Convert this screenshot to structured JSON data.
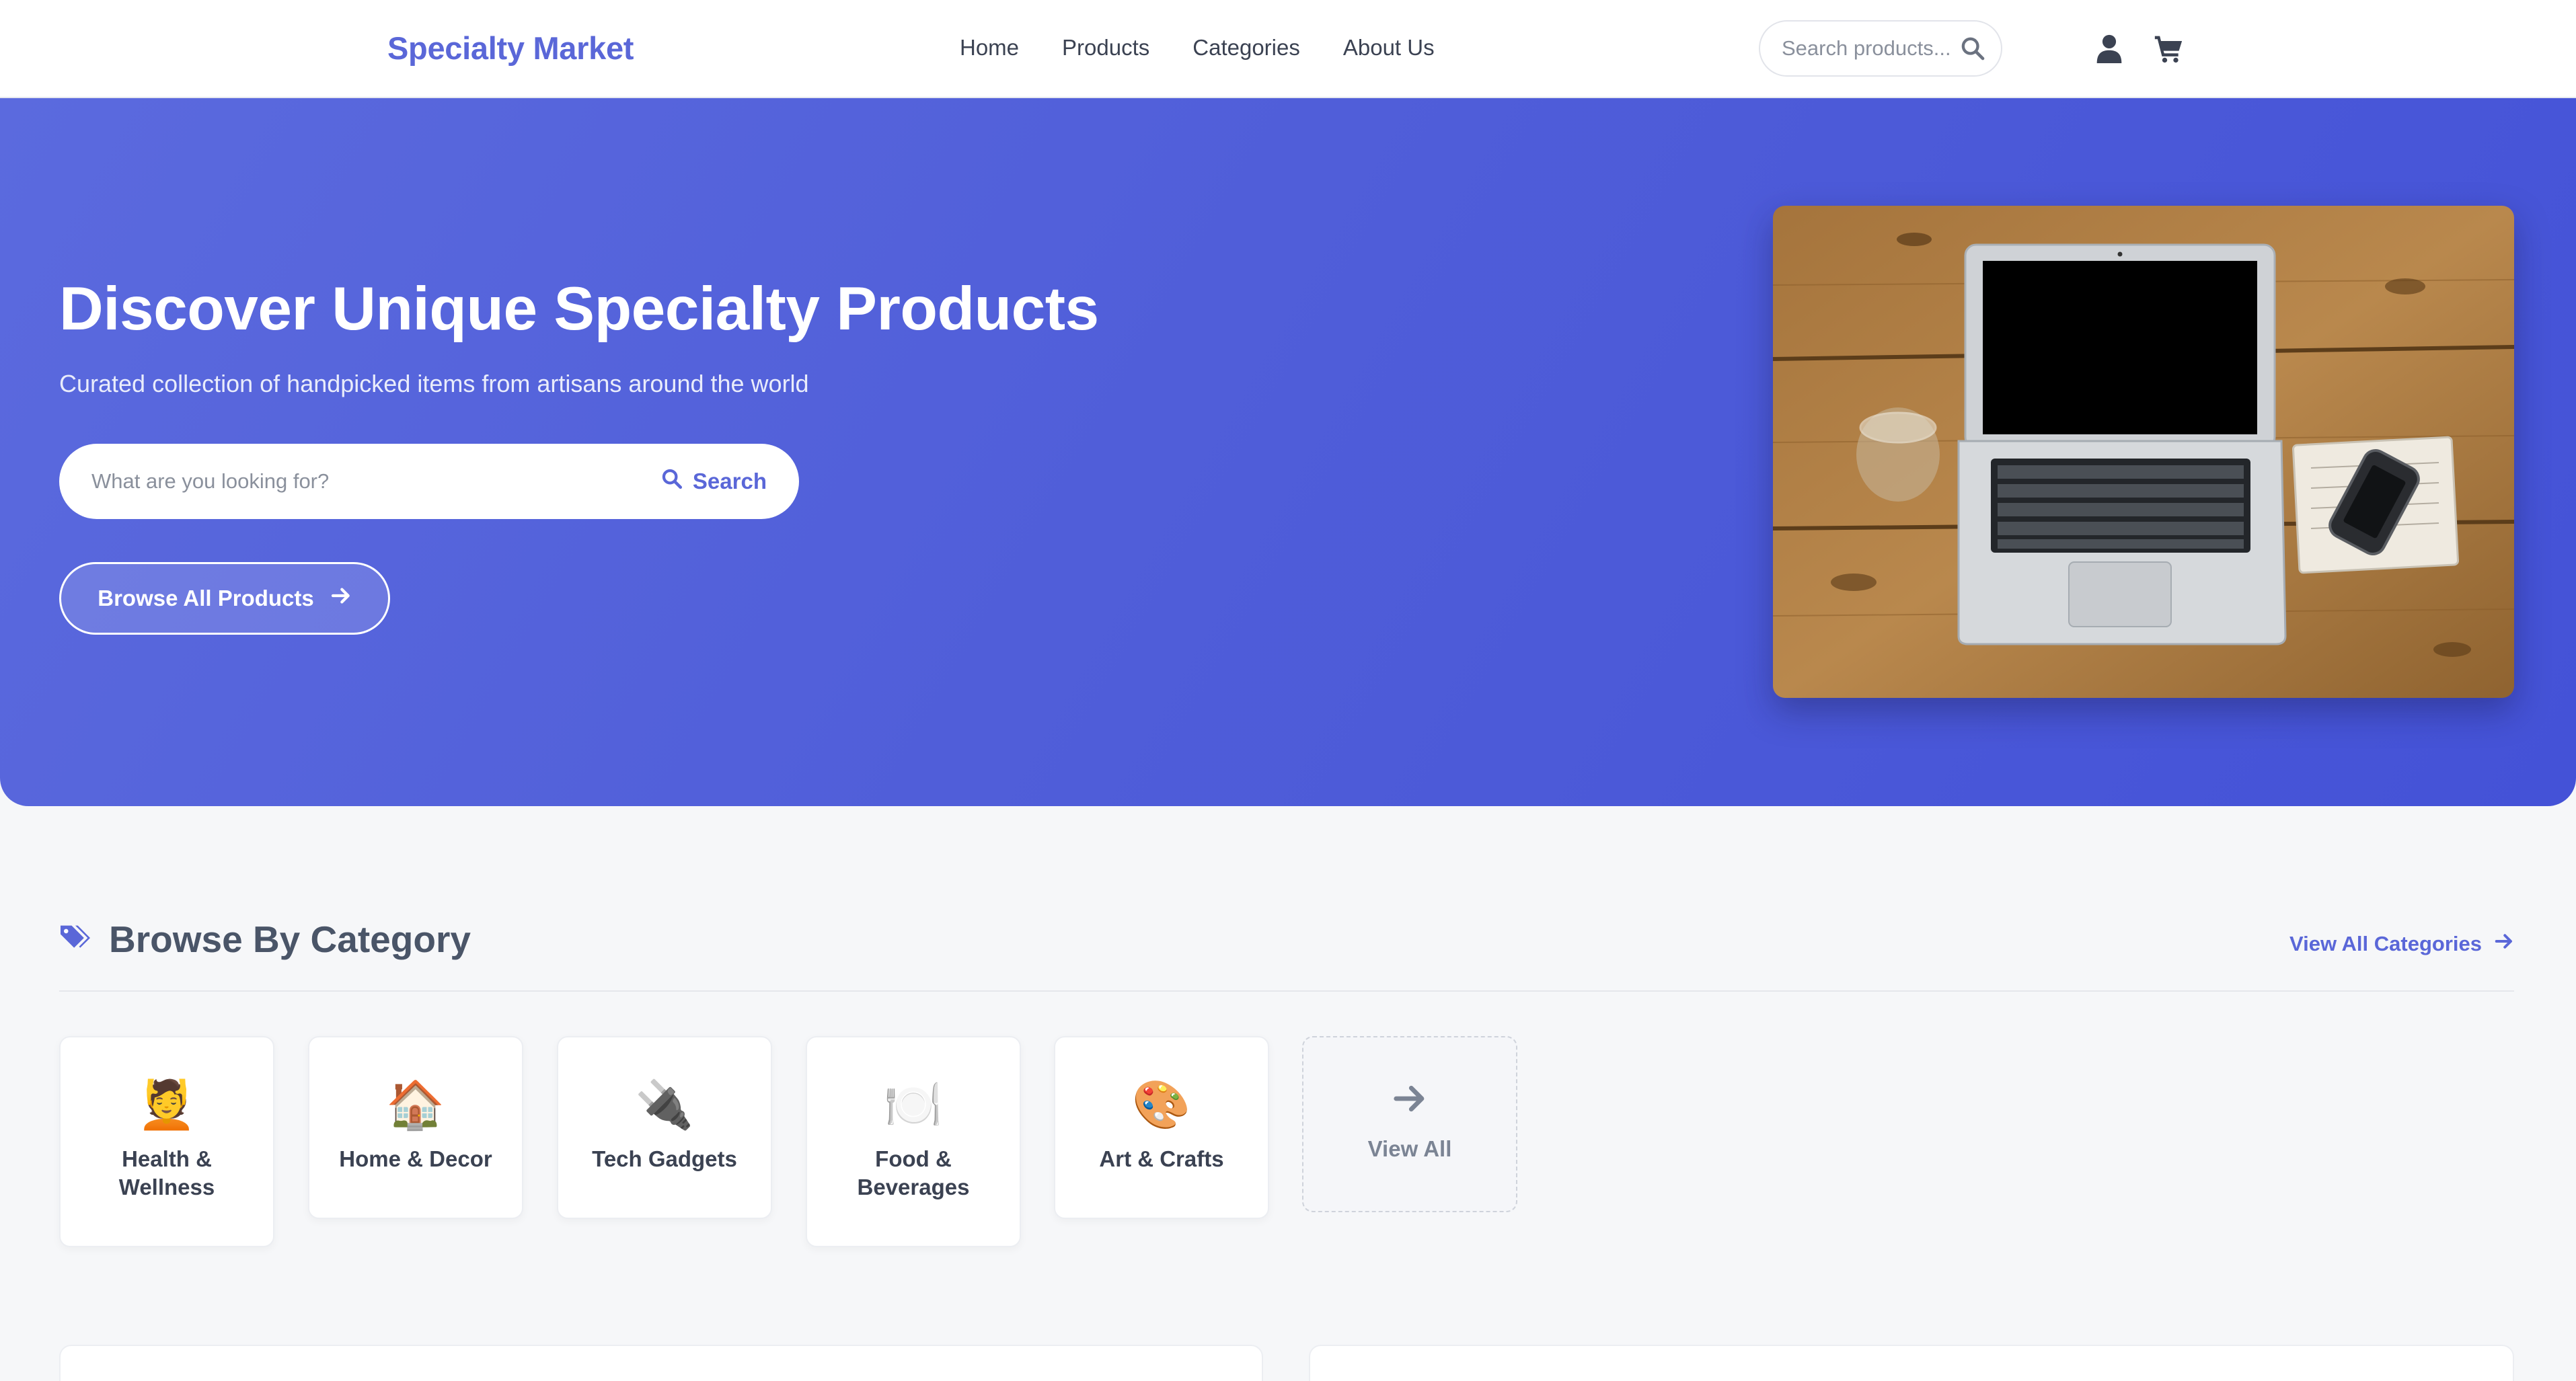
{
  "header": {
    "brand": "Specialty Market",
    "nav": [
      "Home",
      "Products",
      "Categories",
      "About Us"
    ],
    "search_placeholder": "Search products...",
    "icons": [
      "search-icon",
      "user-icon",
      "cart-icon"
    ]
  },
  "hero": {
    "title": "Discover Unique Specialty Products",
    "subtitle": "Curated collection of handpicked items from artisans around the world",
    "search_placeholder": "What are you looking for?",
    "search_button": "Search",
    "browse_button": "Browse All Products"
  },
  "categories": {
    "title": "Browse By Category",
    "view_all_link": "View All Categories",
    "items": [
      {
        "emoji": "💆",
        "label": "Health & Wellness"
      },
      {
        "emoji": "🏠",
        "label": "Home & Decor"
      },
      {
        "emoji": "🔌",
        "label": "Tech Gadgets"
      },
      {
        "emoji": "🍽️",
        "label": "Food & Beverages"
      },
      {
        "emoji": "🎨",
        "label": "Art & Crafts"
      }
    ],
    "view_all_card": "View All"
  },
  "colors": {
    "accent": "#5a67d8",
    "hero_start": "#5b6ade",
    "hero_end": "#4452d7",
    "background": "#f6f7f9"
  }
}
